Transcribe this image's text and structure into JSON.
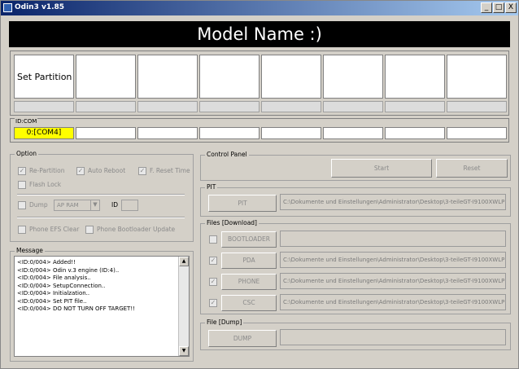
{
  "window": {
    "title": "Odin3 v1.85",
    "minimize": "_",
    "restore": "□",
    "close": "X"
  },
  "model": {
    "name": "Model Name :)"
  },
  "partition": {
    "label": "Set Partition"
  },
  "com": {
    "legend": "ID:COM",
    "active_port": "0:[COM4]"
  },
  "option": {
    "legend": "Option",
    "re_partition": {
      "label": "Re-Partition",
      "checked": true
    },
    "auto_reboot": {
      "label": "Auto Reboot",
      "checked": true
    },
    "f_reset_time": {
      "label": "F. Reset Time",
      "checked": true
    },
    "flash_lock": {
      "label": "Flash Lock",
      "checked": false
    },
    "dump": {
      "label": "Dump",
      "checked": false
    },
    "dump_target": "AP RAM",
    "id_label": "ID",
    "phone_efs_clear": {
      "label": "Phone EFS Clear",
      "checked": false
    },
    "phone_bootloader_update": {
      "label": "Phone Bootloader Update",
      "checked": false
    }
  },
  "message": {
    "legend": "Message",
    "lines": [
      "<ID:0/004> Added!!",
      "<ID:0/004> Odin v.3 engine (ID:4)..",
      "<ID:0/004> File analysis..",
      "<ID:0/004> SetupConnection..",
      "<ID:0/004> Initialzation..",
      "<ID:0/004> Set PIT file..",
      "<ID:0/004> DO NOT TURN OFF TARGET!!"
    ]
  },
  "control_panel": {
    "legend": "Control Panel",
    "start": "Start",
    "reset": "Reset"
  },
  "pit": {
    "legend": "PIT",
    "button": "PIT",
    "path": "C:\\Dokumente und Einstellungen\\Administrator\\Desktop\\3-teileGT-I9100XWLP|"
  },
  "files": {
    "legend": "Files [Download]",
    "bootloader": {
      "button": "BOOTLOADER",
      "checked": false,
      "path": ""
    },
    "pda": {
      "button": "PDA",
      "checked": true,
      "path": "C:\\Dokumente und Einstellungen\\Administrator\\Desktop\\3-teileGT-I9100XWLP|"
    },
    "phone": {
      "button": "PHONE",
      "checked": true,
      "path": "C:\\Dokumente und Einstellungen\\Administrator\\Desktop\\3-teileGT-I9100XWLP|"
    },
    "csc": {
      "button": "CSC",
      "checked": true,
      "path": "C:\\Dokumente und Einstellungen\\Administrator\\Desktop\\3-teileGT-I9100XWLP|"
    }
  },
  "file_dump": {
    "legend": "File [Dump]",
    "button": "DUMP",
    "path": ""
  },
  "colors": {
    "title_start": "#0a246a",
    "title_end": "#a6caf0",
    "com_active": "#ffff00",
    "model_bar": "#000000"
  },
  "icons": {
    "check": "✓",
    "scroll_up": "▲",
    "scroll_down": "▼",
    "dropdown": "▼"
  }
}
